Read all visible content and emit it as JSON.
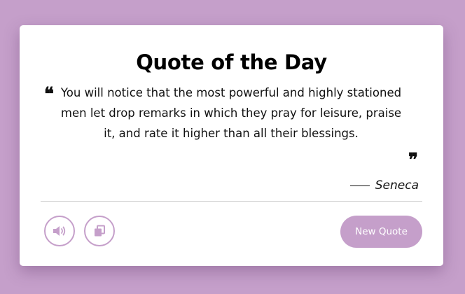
{
  "card": {
    "title": "Quote of the Day",
    "quote": "You will notice that the most powerful and highly stationed men let drop remarks in which they pray for leisure, praise it, and rate it higher than all their blessings.",
    "author": "Seneca"
  },
  "actions": {
    "speak_icon": "volume-icon",
    "copy_icon": "copy-icon",
    "new_quote_label": "New Quote"
  },
  "colors": {
    "background": "#c59fca",
    "accent": "#c59fca",
    "card": "#ffffff",
    "text": "#111111"
  }
}
